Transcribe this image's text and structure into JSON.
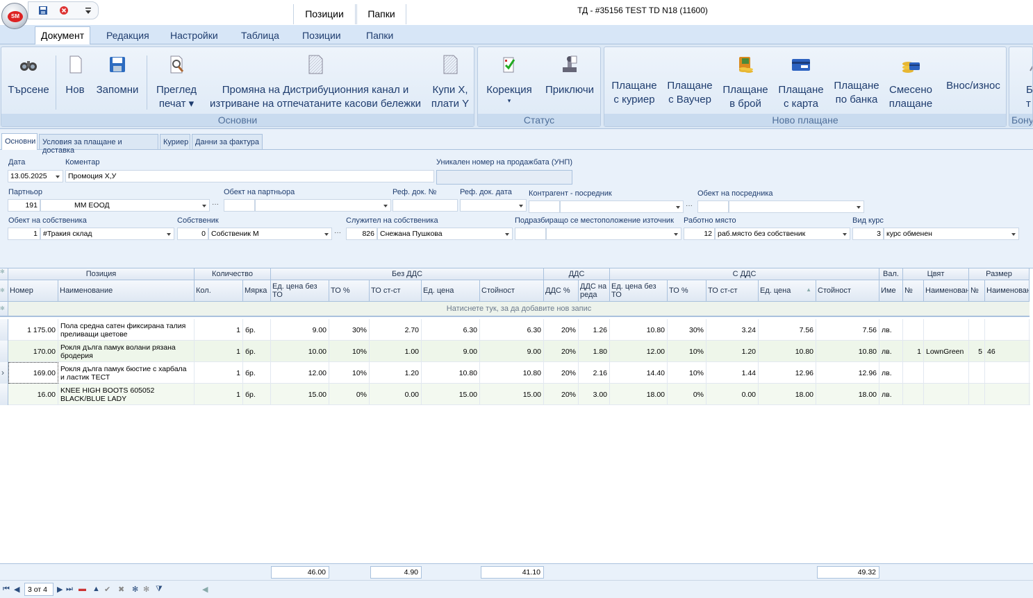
{
  "window": {
    "title": "ТД - #35156 TEST TD N18 (11600)"
  },
  "context_tabs": [
    "Позиции",
    "Папки"
  ],
  "ribbon_tabs": [
    "Документ",
    "Редакция",
    "Настройки",
    "Таблица",
    "Позиции",
    "Папки"
  ],
  "groups": {
    "osnovni": "Основни",
    "status": "Статус",
    "novo": "Ново плащане",
    "bonus": "Бону"
  },
  "buttons": {
    "search": "Търсене",
    "new": "Нов",
    "save": "Запомни",
    "preview1": "Преглед",
    "preview2": "печат",
    "change1": "Промяна на Дистрибуционния канал и",
    "change2": "изтриване на отпечатаните касови бележки",
    "kupi1": "Купи Х,",
    "kupi2": "плати Y",
    "korekcia": "Корекция",
    "prikluchi": "Приключи",
    "courier1": "Плащане",
    "courier2": "с куриер",
    "voucher1": "Плащане",
    "voucher2": "с Ваучер",
    "cash1": "Плащане",
    "cash2": "в брой",
    "card1": "Плащане",
    "card2": "с карта",
    "bank1": "Плащане",
    "bank2": "по банка",
    "mixed1": "Смесено",
    "mixed2": "плащане",
    "vnos": "Внос/износ",
    "bonus1": "Б",
    "bonus2": "т"
  },
  "form_tabs": [
    "Основни",
    "Условия за плащане и доставка",
    "Куриер",
    "Данни за фактура"
  ],
  "form": {
    "date_label": "Дата",
    "date": "13.05.2025",
    "comment_label": "Коментар",
    "comment": "Промоция Х,У",
    "unp_label": "Уникален номер на продажбата (УНП)",
    "unp": "",
    "partner_label": "Партньор",
    "partner_id": "191",
    "partner_name": "ММ ЕООД",
    "partner_obj_label": "Обект на партньора",
    "ref_doc_label": "Реф. док. №",
    "ref_date_label": "Реф. док. дата",
    "kontragent_label": "Контрагент - посредник",
    "posrednik_obj_label": "Обект на посредника",
    "owner_obj_label": "Обект на собственика",
    "owner_obj_id": "1",
    "owner_obj": "#Тракия склад",
    "owner_label": "Собственик",
    "owner_id": "0",
    "owner": "Собственик М",
    "employee_label": "Служител на собственика",
    "employee_id": "826",
    "employee": "Снежана Пушкова",
    "location_label": "Подразбиращо се местоположение източник",
    "workplace_label": "Работно място",
    "workplace_id": "12",
    "workplace": "раб.място без собственик",
    "rate_label": "Вид курс",
    "rate_id": "3",
    "rate": "курс обменен"
  },
  "grid": {
    "bands": [
      "Позиция",
      "Количество",
      "Без ДДС",
      "ДДС",
      "С ДДС",
      "Вал.",
      "Цвят",
      "Размер"
    ],
    "columns": [
      "Номер",
      "Наименование",
      "Кол.",
      "Мярка",
      "Ед. цена без ТО",
      "ТО %",
      "ТО ст-ст",
      "Ед. цена",
      "Стойност",
      "ДДС %",
      "ДДС на реда",
      "Ед. цена без ТО",
      "ТО %",
      "ТО ст-ст",
      "Ед. цена",
      "Стойност",
      "Име",
      "№",
      "Наименование",
      "№",
      "Наименование"
    ],
    "new_row": "Натиснете тук, за да добавите нов запис",
    "rows": [
      [
        "1 175.00",
        "Пола средна сатен фиксирана талия преливащи цветове",
        "1",
        "бр.",
        "9.00",
        "30%",
        "2.70",
        "6.30",
        "6.30",
        "20%",
        "1.26",
        "10.80",
        "30%",
        "3.24",
        "7.56",
        "7.56",
        "лв.",
        "",
        "",
        "",
        ""
      ],
      [
        "170.00",
        "Рокля дълга памук волани рязана бродерия",
        "1",
        "бр.",
        "10.00",
        "10%",
        "1.00",
        "9.00",
        "9.00",
        "20%",
        "1.80",
        "12.00",
        "10%",
        "1.20",
        "10.80",
        "10.80",
        "лв.",
        "1",
        "LownGreen",
        "5",
        "46"
      ],
      [
        "169.00",
        "Рокля дълга памук бюстие с харбала и ластик ТЕСТ",
        "1",
        "бр.",
        "12.00",
        "10%",
        "1.20",
        "10.80",
        "10.80",
        "20%",
        "2.16",
        "14.40",
        "10%",
        "1.44",
        "12.96",
        "12.96",
        "лв.",
        "",
        "",
        "",
        ""
      ],
      [
        "16.00",
        "KNEE HIGH BOOTS 605052 BLACK/BLUE LADY",
        "1",
        "бр.",
        "15.00",
        "0%",
        "0.00",
        "15.00",
        "15.00",
        "20%",
        "3.00",
        "18.00",
        "0%",
        "0.00",
        "18.00",
        "18.00",
        "лв.",
        "",
        "",
        "",
        ""
      ]
    ],
    "totals": {
      "t1": "46.00",
      "t2": "4.90",
      "t3": "41.10",
      "t4": "49.32"
    }
  },
  "nav": {
    "position": "3 от 4"
  }
}
